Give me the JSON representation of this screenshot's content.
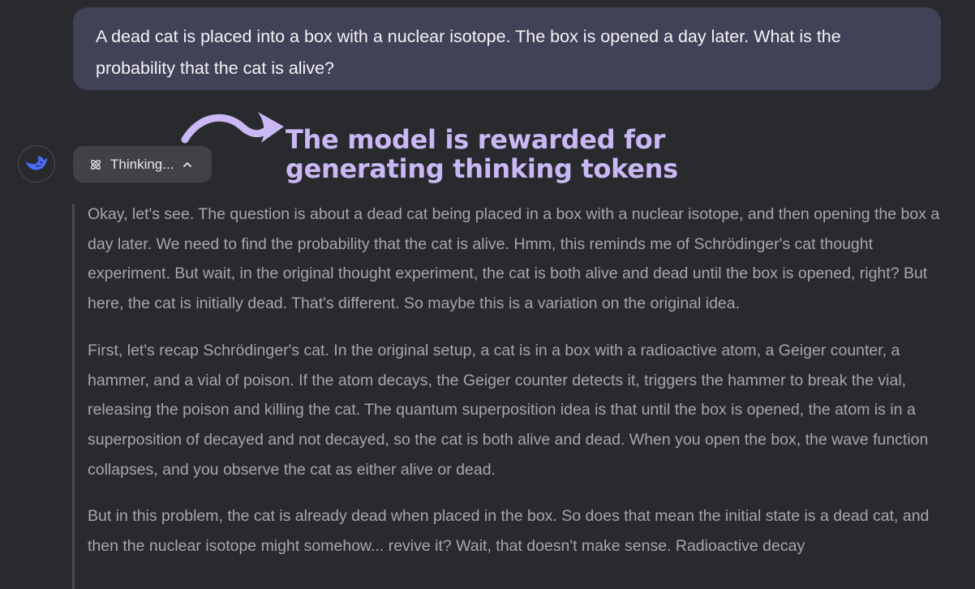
{
  "user_message": {
    "text": "A dead cat is placed into a box with a nuclear isotope. The box is opened a day later. What is the probability that the cat is alive?"
  },
  "assistant": {
    "avatar_icon": "deepseek-whale-icon",
    "thinking_button": {
      "icon": "atom-icon",
      "label": "Thinking...",
      "chevron": "chevron-up-icon"
    },
    "thought_paragraphs": [
      "Okay, let's see. The question is about a dead cat being placed in a box with a nuclear isotope, and then opening the box a day later. We need to find the probability that the cat is alive. Hmm, this reminds me of Schrödinger's cat thought experiment. But wait, in the original thought experiment, the cat is both alive and dead until the box is opened, right? But here, the cat is initially dead. That's different. So maybe this is a variation on the original idea.",
      "First, let's recap Schrödinger's cat. In the original setup, a cat is in a box with a radioactive atom, a Geiger counter, a hammer, and a vial of poison. If the atom decays, the Geiger counter detects it, triggers the hammer to break the vial, releasing the poison and killing the cat. The quantum superposition idea is that until the box is opened, the atom is in a superposition of decayed and not decayed, so the cat is both alive and dead. When you open the box, the wave function collapses, and you observe the cat as either alive or dead.",
      "But in this problem, the cat is already dead when placed in the box. So does that mean the initial state is a dead cat, and then the nuclear isotope might somehow... revive it? Wait, that doesn't make sense. Radioactive decay"
    ]
  },
  "annotation": {
    "line1": "The model is rewarded for",
    "line2": "generating thinking tokens"
  },
  "colors": {
    "background": "#292a2d",
    "user_bubble": "#414158",
    "thinking_button": "#414246",
    "annotation": "#c9b8f5",
    "avatar_accent": "#4d6bfe",
    "thought_text": "#a6a7ab"
  }
}
